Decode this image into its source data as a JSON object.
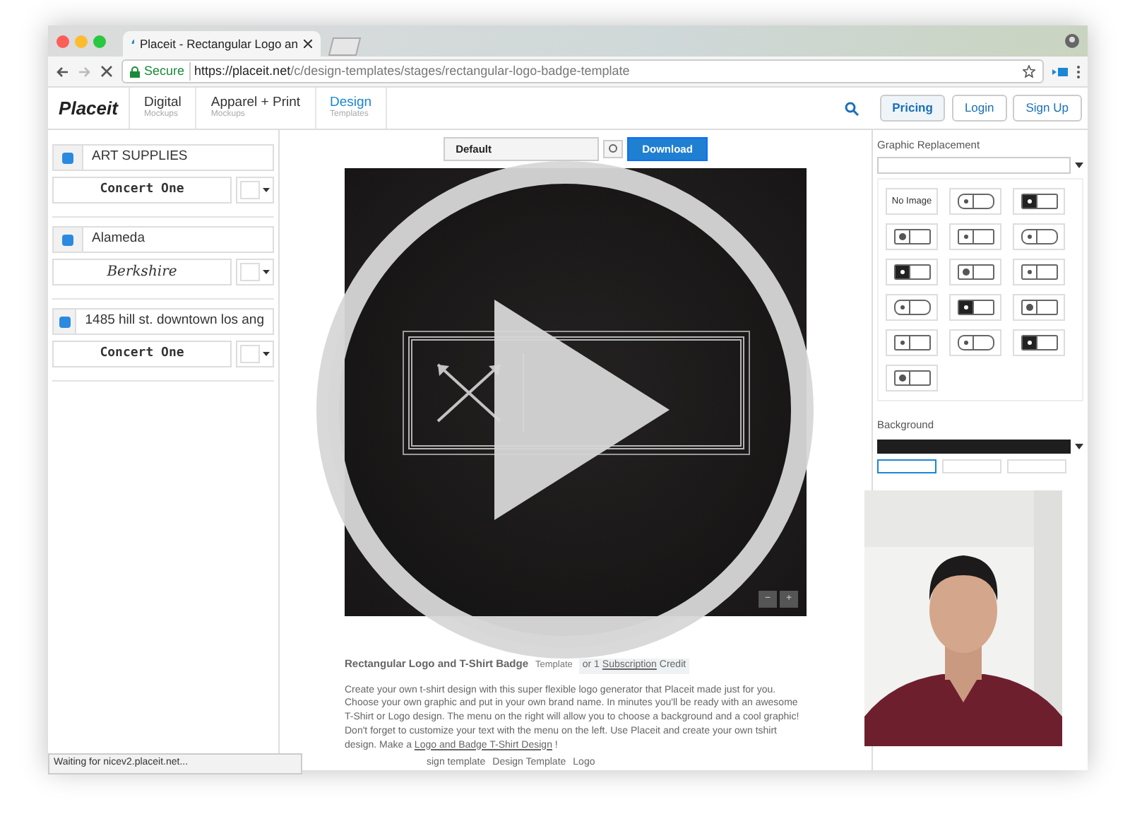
{
  "browser": {
    "tab_title": "Placeit - Rectangular Logo an",
    "url_secure": "Secure",
    "url_host": "https://placeit.net",
    "url_path": "/c/design-templates/stages/rectangular-logo-badge-template",
    "status": "Waiting for nicev2.placeit.net..."
  },
  "header": {
    "logo": "Placeit",
    "nav": [
      {
        "label": "Digital",
        "sub": "Mockups",
        "selected": false
      },
      {
        "label": "Apparel + Print",
        "sub": "Mockups",
        "selected": false
      },
      {
        "label": "Design",
        "sub": "Templates",
        "selected": true
      }
    ],
    "buttons": [
      {
        "label": "Pricing",
        "highlighted": true
      },
      {
        "label": "Login",
        "highlighted": false
      },
      {
        "label": "Sign Up",
        "highlighted": false
      }
    ]
  },
  "layers": [
    {
      "checked": true,
      "text": "ART SUPPLIES",
      "font": "Concert One",
      "kind": "display"
    },
    {
      "checked": true,
      "text": "Alameda",
      "font": "Berkshire",
      "kind": "script"
    },
    {
      "checked": true,
      "text": "1485 hill st. downtown los ang",
      "font": "Concert One",
      "kind": "display"
    }
  ],
  "toolbar": {
    "size_preset": "Default",
    "download": "Download"
  },
  "preview": {
    "zoom_buttons": [
      "−",
      "+"
    ]
  },
  "description": {
    "title": "Rectangular Logo and T-Shirt Badge",
    "title_suffix": "Template",
    "price": "or 1",
    "price_link": "Subscription",
    "price_suffix": "Credit",
    "body": "Create your own t-shirt design with this super flexible logo generator that Placeit made just for you. Choose your own graphic and put in your own brand name. In minutes you'll be ready with an awesome T-Shirt or Logo design. The menu on the right will allow you to choose a background and a cool graphic! Don't forget to customize your text with the menu on the left. Use Placeit and create your own tshirt design. Make a",
    "body_link": "Logo and Badge T-Shirt Design",
    "body_end": "!",
    "tags": [
      "sign template",
      "Design Template",
      "Logo"
    ]
  },
  "right_panel": {
    "graphic_title": "Graphic Replacement",
    "graphics": [
      {
        "kind": "none",
        "label": "No Image"
      },
      {
        "kind": "graphic"
      },
      {
        "kind": "graphic"
      },
      {
        "kind": "graphic"
      },
      {
        "kind": "graphic"
      },
      {
        "kind": "graphic"
      },
      {
        "kind": "graphic"
      },
      {
        "kind": "graphic"
      },
      {
        "kind": "graphic"
      },
      {
        "kind": "graphic"
      },
      {
        "kind": "graphic"
      },
      {
        "kind": "graphic"
      },
      {
        "kind": "graphic"
      },
      {
        "kind": "graphic"
      },
      {
        "kind": "graphic"
      },
      {
        "kind": "graphic"
      }
    ],
    "background_title": "Background"
  }
}
